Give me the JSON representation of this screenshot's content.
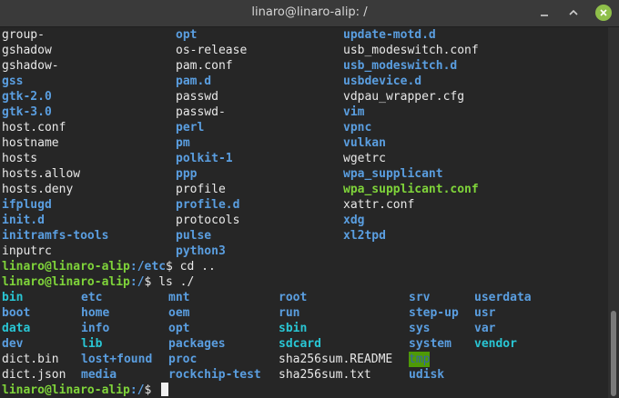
{
  "window": {
    "title": "linaro@linaro-alip: /"
  },
  "listing_etc": [
    [
      {
        "t": "group-",
        "c": "plain"
      },
      {
        "t": "opt",
        "c": "dir"
      },
      {
        "t": "update-motd.d",
        "c": "dir"
      }
    ],
    [
      {
        "t": "gshadow",
        "c": "plain"
      },
      {
        "t": "os-release",
        "c": "plain"
      },
      {
        "t": "usb_modeswitch.conf",
        "c": "plain"
      }
    ],
    [
      {
        "t": "gshadow-",
        "c": "plain"
      },
      {
        "t": "pam.conf",
        "c": "plain"
      },
      {
        "t": "usb_modeswitch.d",
        "c": "dir"
      }
    ],
    [
      {
        "t": "gss",
        "c": "dir"
      },
      {
        "t": "pam.d",
        "c": "dir"
      },
      {
        "t": "usbdevice.d",
        "c": "dir"
      }
    ],
    [
      {
        "t": "gtk-2.0",
        "c": "dir"
      },
      {
        "t": "passwd",
        "c": "plain"
      },
      {
        "t": "vdpau_wrapper.cfg",
        "c": "plain"
      }
    ],
    [
      {
        "t": "gtk-3.0",
        "c": "dir"
      },
      {
        "t": "passwd-",
        "c": "plain"
      },
      {
        "t": "vim",
        "c": "dir"
      }
    ],
    [
      {
        "t": "host.conf",
        "c": "plain"
      },
      {
        "t": "perl",
        "c": "dir"
      },
      {
        "t": "vpnc",
        "c": "dir"
      }
    ],
    [
      {
        "t": "hostname",
        "c": "plain"
      },
      {
        "t": "pm",
        "c": "dir"
      },
      {
        "t": "vulkan",
        "c": "dir"
      }
    ],
    [
      {
        "t": "hosts",
        "c": "plain"
      },
      {
        "t": "polkit-1",
        "c": "dir"
      },
      {
        "t": "wgetrc",
        "c": "plain"
      }
    ],
    [
      {
        "t": "hosts.allow",
        "c": "plain"
      },
      {
        "t": "ppp",
        "c": "dir"
      },
      {
        "t": "wpa_supplicant",
        "c": "dir"
      }
    ],
    [
      {
        "t": "hosts.deny",
        "c": "plain"
      },
      {
        "t": "profile",
        "c": "plain"
      },
      {
        "t": "wpa_supplicant.conf",
        "c": "exe"
      }
    ],
    [
      {
        "t": "ifplugd",
        "c": "dir"
      },
      {
        "t": "profile.d",
        "c": "dir"
      },
      {
        "t": "xattr.conf",
        "c": "plain"
      }
    ],
    [
      {
        "t": "init.d",
        "c": "dir"
      },
      {
        "t": "protocols",
        "c": "plain"
      },
      {
        "t": "xdg",
        "c": "dir"
      }
    ],
    [
      {
        "t": "initramfs-tools",
        "c": "dir"
      },
      {
        "t": "pulse",
        "c": "dir"
      },
      {
        "t": "xl2tpd",
        "c": "dir"
      }
    ],
    [
      {
        "t": "inputrc",
        "c": "plain"
      },
      {
        "t": "python3",
        "c": "dir"
      },
      {
        "t": "",
        "c": "plain"
      }
    ]
  ],
  "prompt1": {
    "user": "linaro@linaro-alip",
    "path": ":/etc",
    "cmd": "$ cd .."
  },
  "prompt2": {
    "user": "linaro@linaro-alip",
    "path": ":/",
    "cmd": "$ ls ./"
  },
  "listing_root": [
    [
      {
        "t": "bin",
        "c": "cyan"
      },
      {
        "t": "etc",
        "c": "dir"
      },
      {
        "t": "mnt",
        "c": "dir"
      },
      {
        "t": "root",
        "c": "dir"
      },
      {
        "t": "srv",
        "c": "dir"
      },
      {
        "t": "userdata",
        "c": "dir"
      }
    ],
    [
      {
        "t": "boot",
        "c": "dir"
      },
      {
        "t": "home",
        "c": "dir"
      },
      {
        "t": "oem",
        "c": "dir"
      },
      {
        "t": "run",
        "c": "dir"
      },
      {
        "t": "step-up",
        "c": "dir"
      },
      {
        "t": "usr",
        "c": "dir"
      }
    ],
    [
      {
        "t": "data",
        "c": "cyan"
      },
      {
        "t": "info",
        "c": "dir"
      },
      {
        "t": "opt",
        "c": "dir"
      },
      {
        "t": "sbin",
        "c": "cyan"
      },
      {
        "t": "sys",
        "c": "dir"
      },
      {
        "t": "var",
        "c": "dir"
      }
    ],
    [
      {
        "t": "dev",
        "c": "dir"
      },
      {
        "t": "lib",
        "c": "cyan"
      },
      {
        "t": "packages",
        "c": "dir"
      },
      {
        "t": "sdcard",
        "c": "cyan"
      },
      {
        "t": "system",
        "c": "dir"
      },
      {
        "t": "vendor",
        "c": "cyan"
      }
    ],
    [
      {
        "t": "dict.bin",
        "c": "plain"
      },
      {
        "t": "lost+found",
        "c": "dir"
      },
      {
        "t": "proc",
        "c": "dir"
      },
      {
        "t": "sha256sum.README",
        "c": "plain"
      },
      {
        "t": "tmp",
        "c": "hl-tmp"
      },
      {
        "t": "",
        "c": "plain"
      }
    ],
    [
      {
        "t": "dict.json",
        "c": "plain"
      },
      {
        "t": "media",
        "c": "dir"
      },
      {
        "t": "rockchip-test",
        "c": "dir"
      },
      {
        "t": "sha256sum.txt",
        "c": "plain"
      },
      {
        "t": "udisk",
        "c": "dir"
      },
      {
        "t": "",
        "c": "plain"
      }
    ]
  ],
  "prompt3": {
    "user": "linaro@linaro-alip",
    "path": ":/",
    "cmd": "$ "
  },
  "colors": {
    "dir": "#5a9ee0",
    "exe": "#7fd43a",
    "cyan": "#29c6d4",
    "background": "#262626"
  }
}
